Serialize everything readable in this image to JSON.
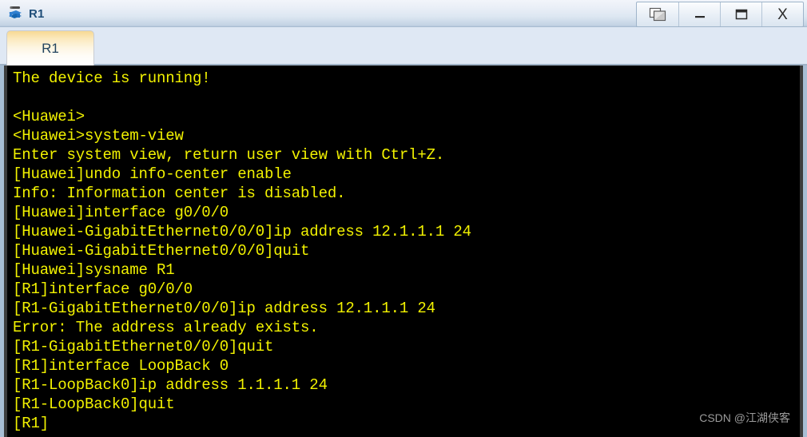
{
  "window": {
    "title": "R1",
    "icon": "router-icon"
  },
  "title_buttons": [
    {
      "name": "cascade-windows-button",
      "icon": "cascade-windows-icon",
      "label": ""
    },
    {
      "name": "minimize-button",
      "icon": "minimize-icon",
      "label": ""
    },
    {
      "name": "maximize-button",
      "icon": "maximize-icon",
      "label": ""
    },
    {
      "name": "close-button",
      "icon": "close-icon",
      "label": "X"
    }
  ],
  "tabs": [
    {
      "label": "R1",
      "active": true
    }
  ],
  "terminal": {
    "foreground_color": "#f2f200",
    "background_color": "#000000",
    "lines": [
      "The device is running!",
      "",
      "<Huawei>",
      "<Huawei>system-view",
      "Enter system view, return user view with Ctrl+Z.",
      "[Huawei]undo info-center enable",
      "Info: Information center is disabled.",
      "[Huawei]interface g0/0/0",
      "[Huawei-GigabitEthernet0/0/0]ip address 12.1.1.1 24",
      "[Huawei-GigabitEthernet0/0/0]quit",
      "[Huawei]sysname R1",
      "[R1]interface g0/0/0",
      "[R1-GigabitEthernet0/0/0]ip address 12.1.1.1 24",
      "Error: The address already exists.",
      "[R1-GigabitEthernet0/0/0]quit",
      "[R1]interface LoopBack 0",
      "[R1-LoopBack0]ip address 1.1.1.1 24",
      "[R1-LoopBack0]quit",
      "[R1]"
    ]
  },
  "watermark": {
    "text": "CSDN @江湖侠客"
  }
}
